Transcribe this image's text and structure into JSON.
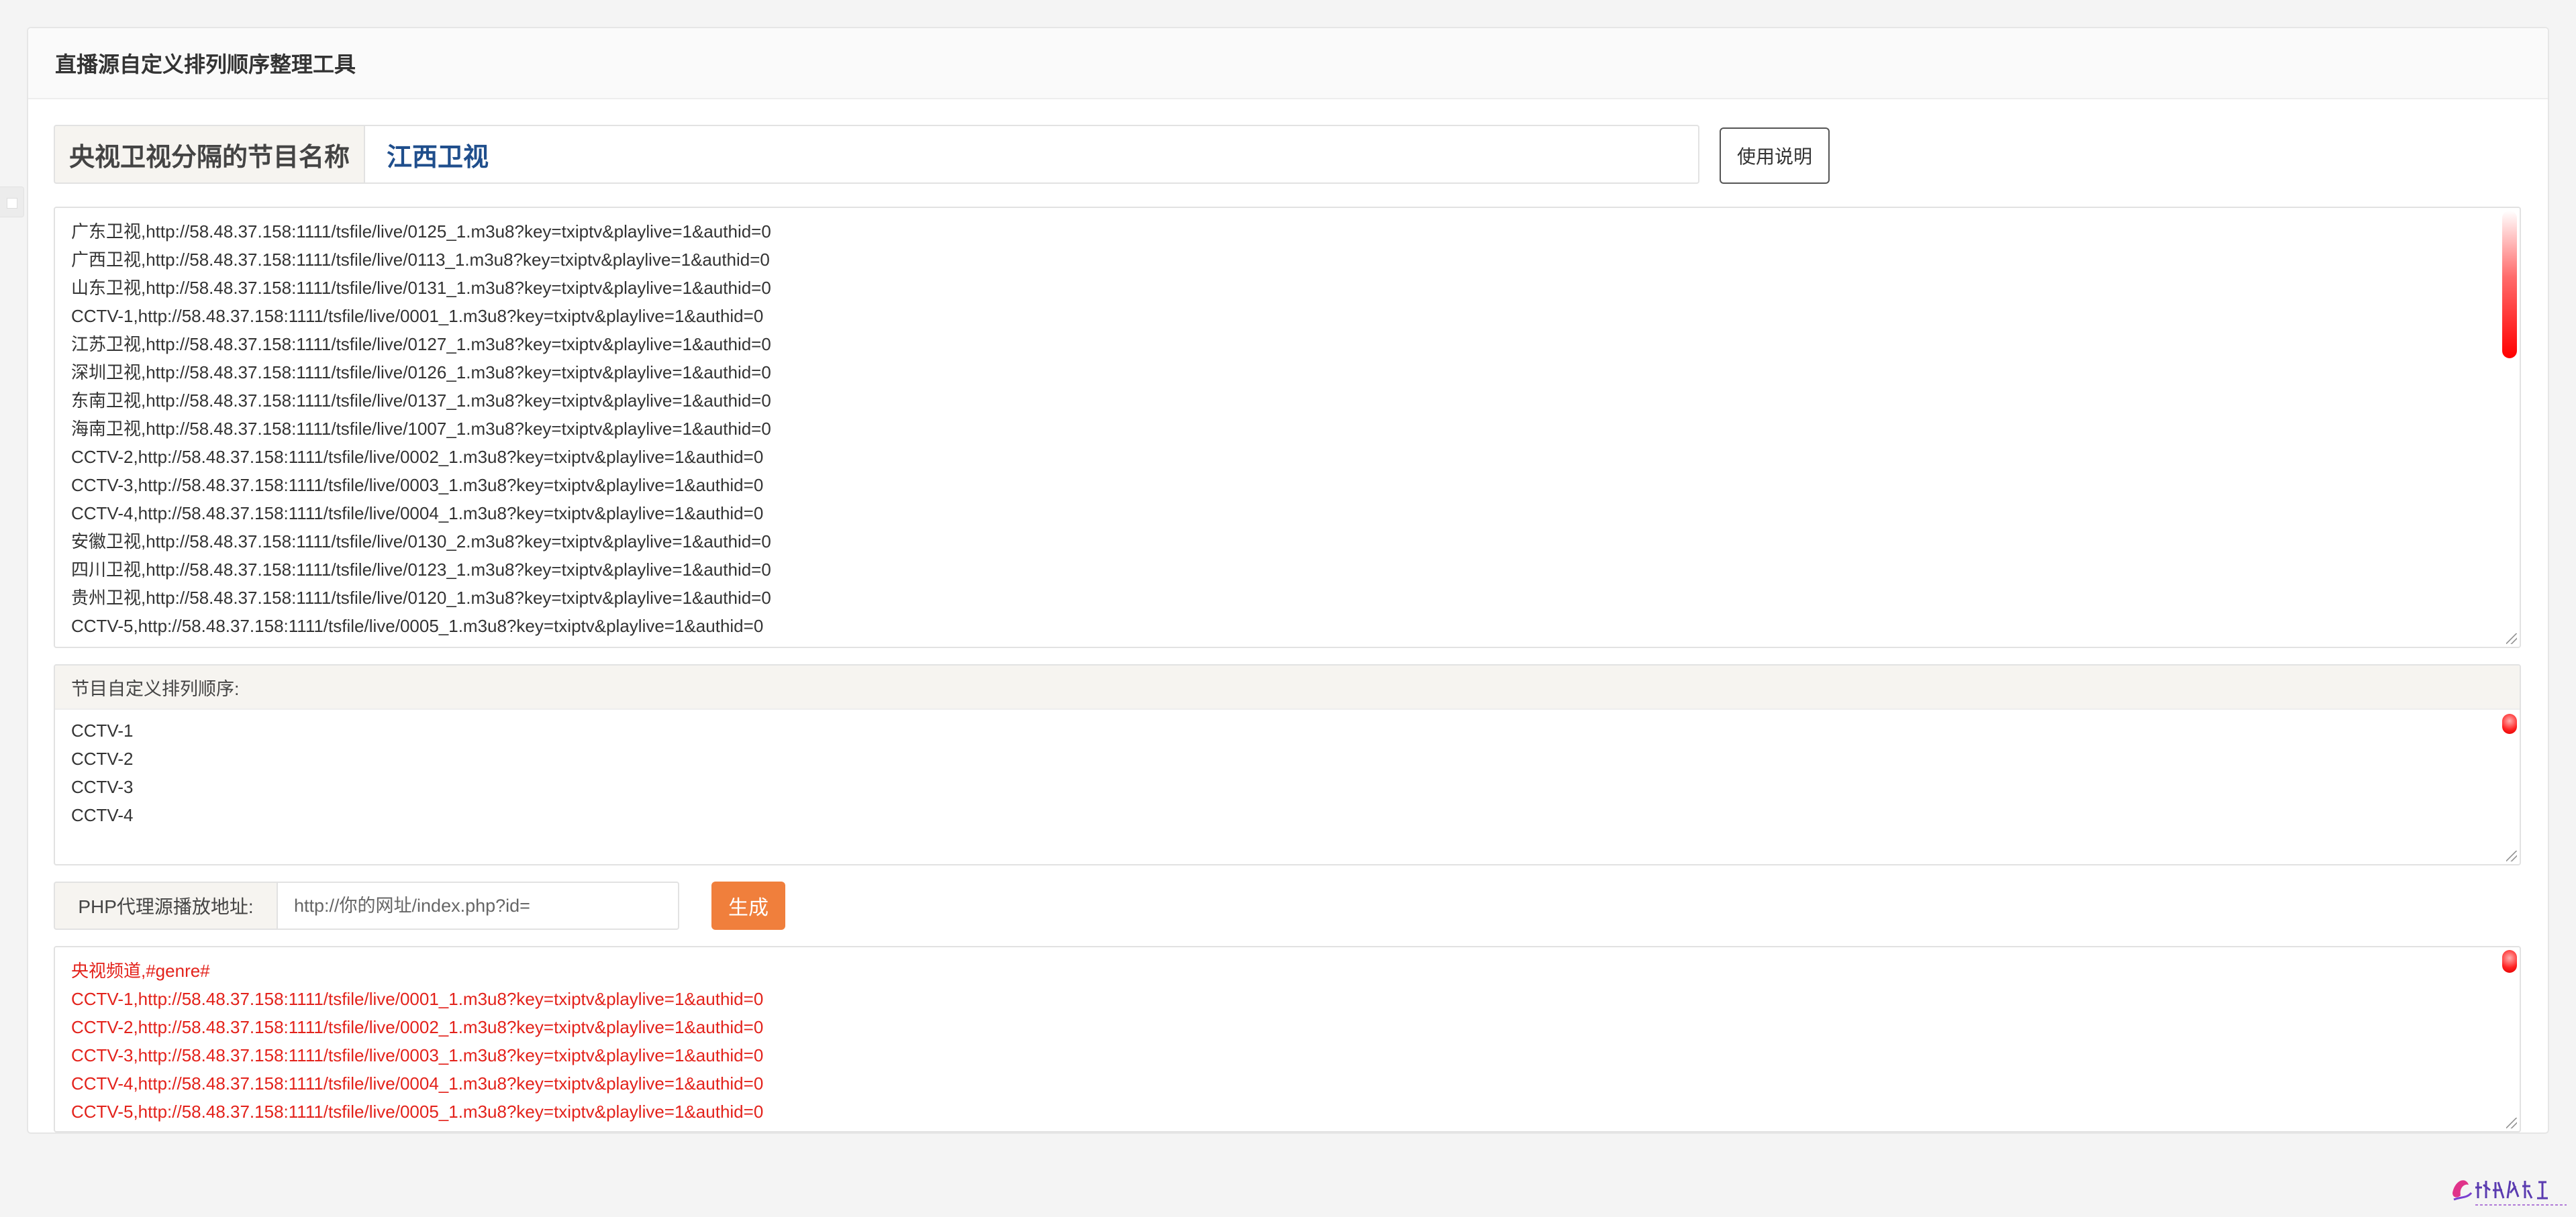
{
  "panel": {
    "title": "直播源自定义排列顺序整理工具"
  },
  "name_row": {
    "label": "央视卫视分隔的节目名称",
    "value": "江西卫视"
  },
  "help_button": {
    "label": "使用说明"
  },
  "source_lines": [
    "广东卫视,http://58.48.37.158:1111/tsfile/live/0125_1.m3u8?key=txiptv&playlive=1&authid=0",
    "广西卫视,http://58.48.37.158:1111/tsfile/live/0113_1.m3u8?key=txiptv&playlive=1&authid=0",
    "山东卫视,http://58.48.37.158:1111/tsfile/live/0131_1.m3u8?key=txiptv&playlive=1&authid=0",
    "CCTV-1,http://58.48.37.158:1111/tsfile/live/0001_1.m3u8?key=txiptv&playlive=1&authid=0",
    "江苏卫视,http://58.48.37.158:1111/tsfile/live/0127_1.m3u8?key=txiptv&playlive=1&authid=0",
    "深圳卫视,http://58.48.37.158:1111/tsfile/live/0126_1.m3u8?key=txiptv&playlive=1&authid=0",
    "东南卫视,http://58.48.37.158:1111/tsfile/live/0137_1.m3u8?key=txiptv&playlive=1&authid=0",
    "海南卫视,http://58.48.37.158:1111/tsfile/live/1007_1.m3u8?key=txiptv&playlive=1&authid=0",
    "CCTV-2,http://58.48.37.158:1111/tsfile/live/0002_1.m3u8?key=txiptv&playlive=1&authid=0",
    "CCTV-3,http://58.48.37.158:1111/tsfile/live/0003_1.m3u8?key=txiptv&playlive=1&authid=0",
    "CCTV-4,http://58.48.37.158:1111/tsfile/live/0004_1.m3u8?key=txiptv&playlive=1&authid=0",
    "安徽卫视,http://58.48.37.158:1111/tsfile/live/0130_2.m3u8?key=txiptv&playlive=1&authid=0",
    "四川卫视,http://58.48.37.158:1111/tsfile/live/0123_1.m3u8?key=txiptv&playlive=1&authid=0",
    "贵州卫视,http://58.48.37.158:1111/tsfile/live/0120_1.m3u8?key=txiptv&playlive=1&authid=0",
    "CCTV-5,http://58.48.37.158:1111/tsfile/live/0005_1.m3u8?key=txiptv&playlive=1&authid=0"
  ],
  "order": {
    "label": "节目自定义排列顺序:",
    "lines": [
      "CCTV-1",
      "CCTV-2",
      "CCTV-3",
      "CCTV-4"
    ]
  },
  "proxy": {
    "label": "PHP代理源播放地址:",
    "placeholder": "http://你的网址/index.php?id=",
    "generate_label": "生成"
  },
  "output_lines": [
    "央视频道,#genre#",
    "CCTV-1,http://58.48.37.158:1111/tsfile/live/0001_1.m3u8?key=txiptv&playlive=1&authid=0",
    "CCTV-2,http://58.48.37.158:1111/tsfile/live/0002_1.m3u8?key=txiptv&playlive=1&authid=0",
    "CCTV-3,http://58.48.37.158:1111/tsfile/live/0003_1.m3u8?key=txiptv&playlive=1&authid=0",
    "CCTV-4,http://58.48.37.158:1111/tsfile/live/0004_1.m3u8?key=txiptv&playlive=1&authid=0",
    "CCTV-5,http://58.48.37.158:1111/tsfile/live/0005_1.m3u8?key=txiptv&playlive=1&authid=0"
  ],
  "colors": {
    "output_text": "#e3221b",
    "generate_button": "#f07f3c",
    "name_value": "#1f4e8c"
  }
}
